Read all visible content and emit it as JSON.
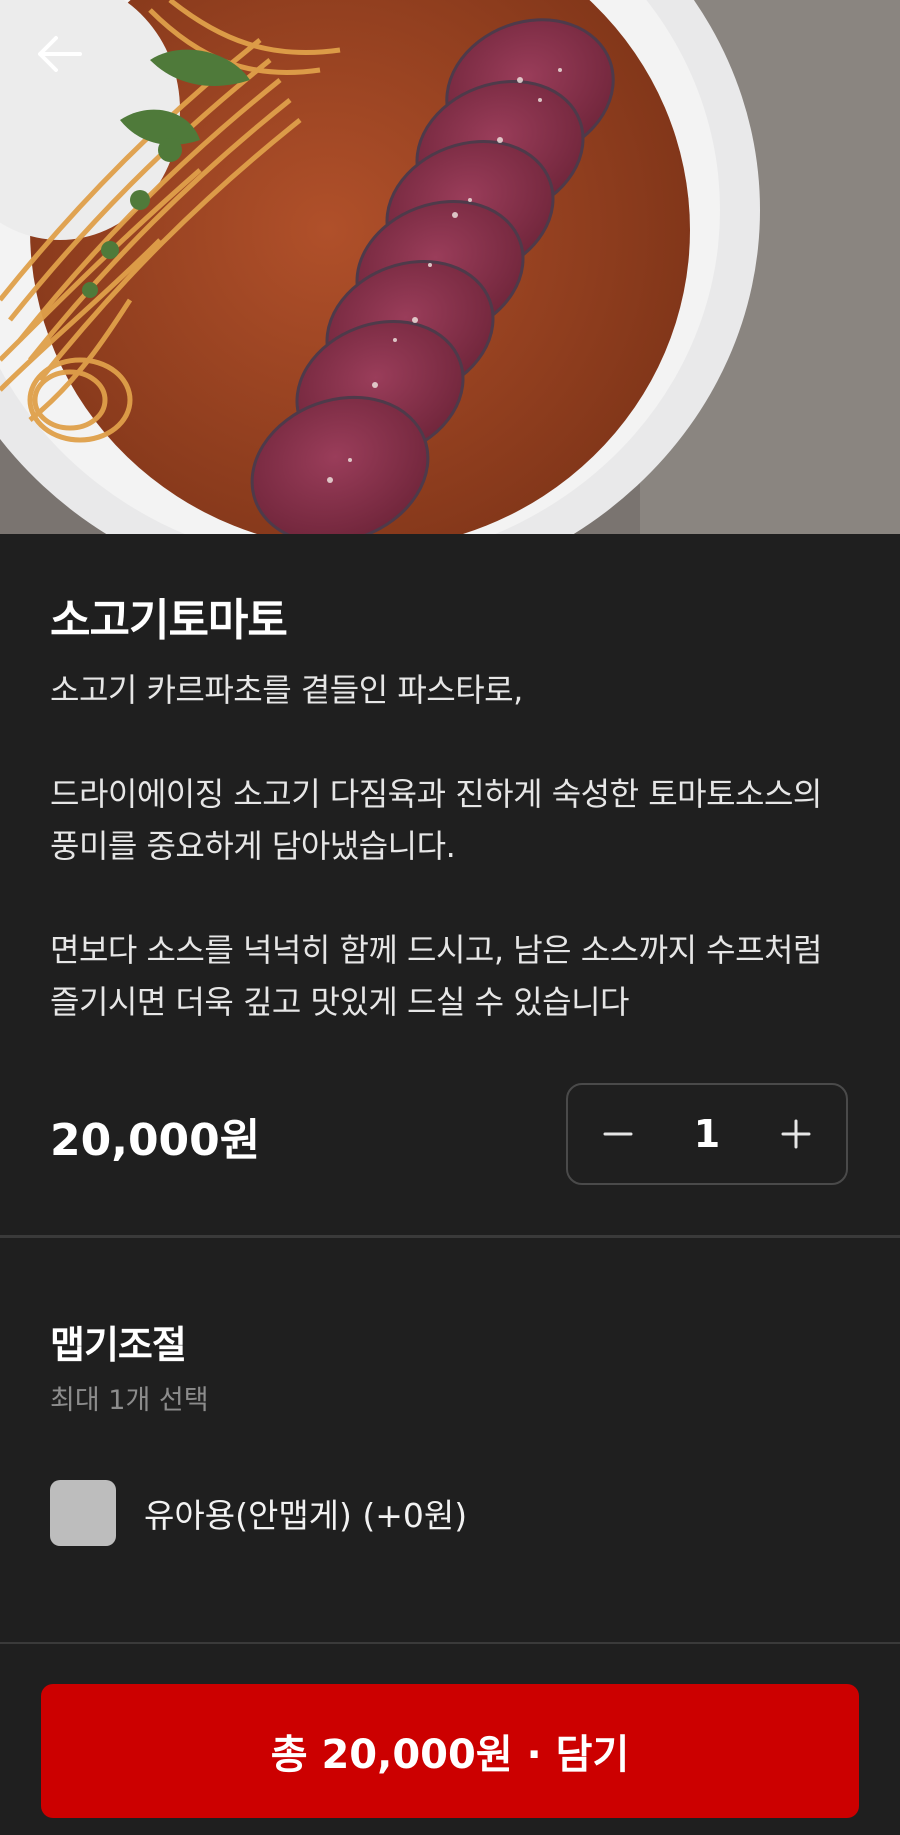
{
  "product": {
    "name": "소고기토마토",
    "description": [
      "소고기 카르파초를 곁들인 파스타로,",
      "드라이에이징 소고기 다짐육과 진하게 숙성한 토마토소스의 풍미를 중요하게 담아냈습니다.",
      "면보다 소스를 넉넉히 함께 드시고, 남은 소스까지 수프처럼 즐기시면 더욱 깊고 맛있게 드실 수 있습니다"
    ],
    "price": "20,000원",
    "quantity": "1"
  },
  "options": {
    "title": "맵기조절",
    "subtitle": "최대 1개 선택",
    "items": [
      {
        "label": "유아용(안맵게) (+0원)",
        "checked": false
      }
    ]
  },
  "cta": {
    "label": "총 20,000원 · 담기"
  },
  "icons": {
    "back": "arrow-left-icon",
    "minus": "minus-icon",
    "plus": "plus-icon"
  },
  "colors": {
    "background": "#1f1f1f",
    "cta": "#cc0000",
    "checkbox": "#bdbdbd"
  }
}
